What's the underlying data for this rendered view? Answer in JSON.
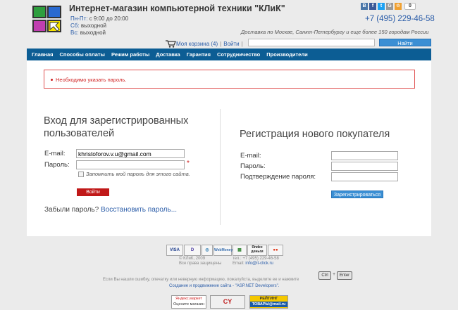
{
  "header": {
    "title": "Интернет-магазин компьютерной техники \"КЛиК\"",
    "hours": [
      {
        "days": "Пн-Пт:",
        "time": "с 9:00 до 20:00"
      },
      {
        "days": "Сб:",
        "time": "выходной"
      },
      {
        "days": "Вс:",
        "time": "выходной"
      }
    ],
    "phone": "+7 (495) 229-46-58",
    "delivery": "Доставка по Москве, Санкт-Петербургу и еще более 150 городам России",
    "social_letters": [
      "В",
      "f",
      "t",
      "G",
      "☆"
    ],
    "social_count": "0",
    "cart_label": "Моя корзина (4)",
    "login_link": "Войти",
    "search_placeholder": "",
    "search_button": "Найти"
  },
  "nav": [
    "Главная",
    "Способы оплаты",
    "Режим работы",
    "Доставка",
    "Гарантия",
    "Сотрудничество",
    "Производители"
  ],
  "error": "Необходимо указать пароль.",
  "login": {
    "title": "Вход для зарегистрированных пользователей",
    "email_label": "E-mail:",
    "email_value": "khristoforov.v.u@gmail.com",
    "password_label": "Пароль:",
    "password_value": "",
    "required_mark": "*",
    "remember_label": "Запомнить мой пароль для этого сайта.",
    "submit": "Войти",
    "forgot_text": "Забыли пароль?",
    "forgot_link": "Восстановить пароль..."
  },
  "register": {
    "title": "Регистрация нового покупателя",
    "email_label": "E-mail:",
    "password_label": "Пароль:",
    "confirm_label": "Подтверждение пароля:",
    "submit": "Зарегистрироваться"
  },
  "footer": {
    "payments": [
      "VISA",
      "D",
      "◎",
      "WebMoney",
      "▦",
      "Яndex деньги",
      "●●"
    ],
    "copyright": "© КЛиК, 2009",
    "rights": "Все права защищены",
    "phone": "тел.: +7 (495) 229-46-58",
    "email_label": "Email:",
    "email": "info@it-click.ru",
    "error_hint": "Если Вы нашли ошибку, опечатку или неверную информацию, пожалуйста, выделите ее и нажмите",
    "key_ctrl": "Ctrl",
    "key_plus": "+",
    "key_enter": "Enter",
    "credits": "Создание и продвижение сайта - \"ASP.NET Developers\".",
    "badge_market_1": "Яндекс.маркет",
    "badge_market_2": "Оцените магазин",
    "badge_rating_1": "РЕЙТИНГ",
    "badge_rating_2": "ТОВАРЫ@mail.ru",
    "counter": "CY"
  },
  "colors": {
    "nav_bg": "#0c5d94",
    "link": "#2a5ca8",
    "error": "#d02020",
    "login_button": "#c01818",
    "blue_button": "#3b8fd4"
  }
}
